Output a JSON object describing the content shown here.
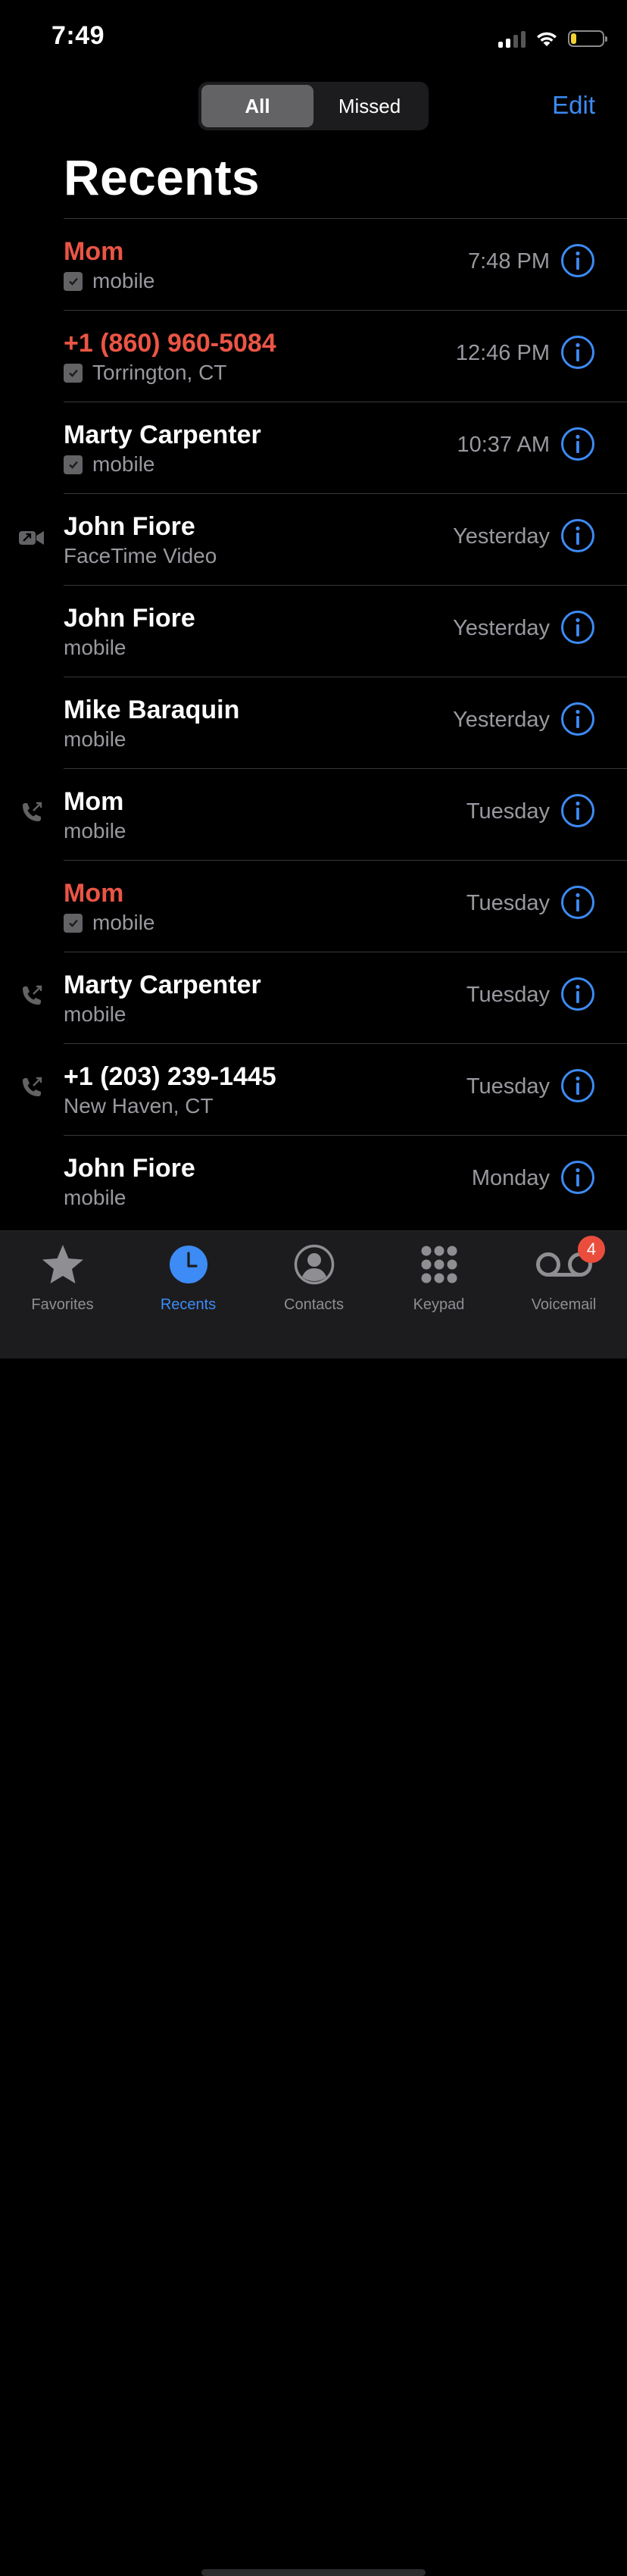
{
  "status_bar": {
    "time": "7:49"
  },
  "header": {
    "segments": [
      "All",
      "Missed"
    ],
    "selected_segment": "All",
    "edit_label": "Edit",
    "title": "Recents"
  },
  "calls": [
    {
      "name": "Mom",
      "detail": "mobile",
      "time": "7:48 PM",
      "missed": true,
      "checkmark": true,
      "lead_icon": ""
    },
    {
      "name": "+1 (860) 960-5084",
      "detail": "Torrington, CT",
      "time": "12:46 PM",
      "missed": true,
      "checkmark": true,
      "lead_icon": ""
    },
    {
      "name": "Marty Carpenter",
      "detail": "mobile",
      "time": "10:37 AM",
      "missed": false,
      "checkmark": true,
      "lead_icon": ""
    },
    {
      "name": "John Fiore",
      "detail": "FaceTime Video",
      "time": "Yesterday",
      "missed": false,
      "checkmark": false,
      "lead_icon": "outgoing-video-icon"
    },
    {
      "name": "John Fiore",
      "detail": "mobile",
      "time": "Yesterday",
      "missed": false,
      "checkmark": false,
      "lead_icon": ""
    },
    {
      "name": "Mike Baraquin",
      "detail": "mobile",
      "time": "Yesterday",
      "missed": false,
      "checkmark": false,
      "lead_icon": ""
    },
    {
      "name": "Mom",
      "detail": "mobile",
      "time": "Tuesday",
      "missed": false,
      "checkmark": false,
      "lead_icon": "outgoing-call-icon"
    },
    {
      "name": "Mom",
      "detail": "mobile",
      "time": "Tuesday",
      "missed": true,
      "checkmark": true,
      "lead_icon": ""
    },
    {
      "name": "Marty Carpenter",
      "detail": "mobile",
      "time": "Tuesday",
      "missed": false,
      "checkmark": false,
      "lead_icon": "outgoing-call-icon"
    },
    {
      "name": "+1 (203) 239-1445",
      "detail": "New Haven, CT",
      "time": "Tuesday",
      "missed": false,
      "checkmark": false,
      "lead_icon": "outgoing-call-icon"
    },
    {
      "name": "John Fiore",
      "detail": "mobile",
      "time": "Monday",
      "missed": false,
      "checkmark": false,
      "lead_icon": ""
    }
  ],
  "tabbar": {
    "tabs": [
      {
        "label": "Favorites",
        "icon": "star-icon"
      },
      {
        "label": "Recents",
        "icon": "clock-icon"
      },
      {
        "label": "Contacts",
        "icon": "person-circle-icon"
      },
      {
        "label": "Keypad",
        "icon": "keypad-icon"
      },
      {
        "label": "Voicemail",
        "icon": "voicemail-icon"
      }
    ],
    "selected": "Recents",
    "voicemail_badge": "4"
  },
  "colors": {
    "accent": "#3d8bf5",
    "missed": "#eb5545",
    "background": "#000000",
    "secondary_text": "#98989f",
    "tabbar": "#1c1c1e",
    "badge": "#eb4d3d",
    "battery_low": "#f2d231"
  }
}
